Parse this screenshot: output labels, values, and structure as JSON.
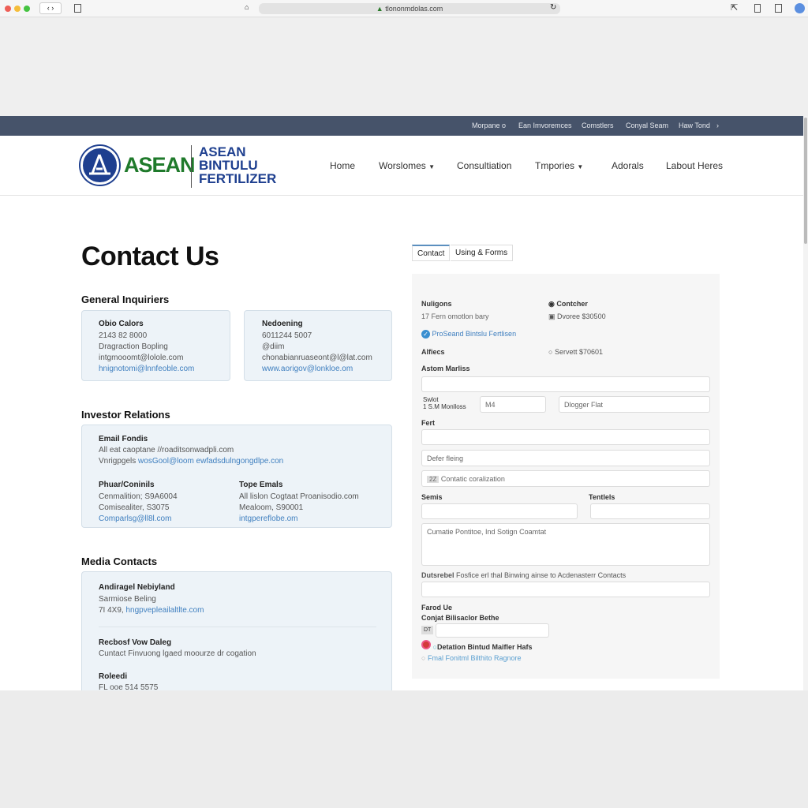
{
  "browser": {
    "url": "tlononmdolas.com"
  },
  "topbar": {
    "links": [
      "Morpane o",
      "Ean Imvoremces",
      "Comstlers",
      "Conyal Seam",
      "Haw Tond"
    ]
  },
  "logo": {
    "word": "ASEAN",
    "line1": "ASEAN",
    "line2": "BINTULU",
    "line3": "FERTILIZER"
  },
  "nav": {
    "items": [
      "Home",
      "Worslomes",
      "Consultiation",
      "Tmpories",
      "Adorals",
      "Labout Heres"
    ]
  },
  "page": {
    "title": "Contact Us"
  },
  "general": {
    "heading": "General Inquiriers",
    "card1": [
      "Obio Calors",
      "2143 82 8000",
      "Dragraction Bopling",
      "intgmooomt@lolole.com",
      "hnignotomi@lnnfeoble.com"
    ],
    "card2": [
      "Nedoening",
      "6011244 5007",
      "@diim",
      "chonabianruaseont@l@lat.com",
      "www.aorigov@lonkloe.om"
    ]
  },
  "investor": {
    "heading": "Investor Relations",
    "email_title": "Email Fondis",
    "email_line1": "All eat caoptane //roaditsonwadpli.com",
    "email_prefix": "Vnrigpgels",
    "email_link": "wosGool@loom ewfadsdulngongdlpe.con",
    "phone_title": "Phuar/Coninils",
    "phone_lines": [
      "Cenmalition; S9A6004",
      "Comisealiter, S3075",
      "Comparlsg@ll8l.com"
    ],
    "type_title": "Tope Emals",
    "type_lines": [
      "All lislon Cogtaat Proanisodio.com",
      "Mealoom, S90001",
      "intgpereflobe.om"
    ]
  },
  "media": {
    "heading": "Media Contacts",
    "c1": [
      "Andiragel Nebiyland",
      "Sarmiose Beling",
      "7I 4X9,",
      "hngpvepleailaltlte.com"
    ],
    "c2": [
      "Recbosf Vow Daleg",
      "Cuntact Finvuong lgaed moourze dr cogation"
    ],
    "c3": [
      "Roleedi",
      "FL ooe 514 5575"
    ]
  },
  "tabs": [
    "Contact",
    "Using & Forms"
  ],
  "form": {
    "l1": "Nuligons",
    "l1sub": "17 Fern omotlon bary",
    "r1": "Contcher",
    "r2": "Dvoree $30500",
    "r3": "Servett $70601",
    "check": "ProSeand Bintslu Fertlisen",
    "l2": "Alfiecs",
    "l3": "Astom Marliss",
    "small_l": "Swlot",
    "small_sub": "1 S.M Monlloss",
    "in_m": "M4",
    "in_p": "Dlogger Flat",
    "l4": "Fert",
    "in_d": "Defer fleing",
    "in_c_badge": "2Z",
    "in_c": "Contatic coralization",
    "l5": "Semis",
    "l6": "Tentlels",
    "textarea": "Cumatie Pontitoe, Ind Sotign Coamtat",
    "l7b": "Dutsrebel",
    "l7": "Fosfice erl thal Binwing ainse to Acdenasterr Contacts",
    "l8": "Farod Ue",
    "l9": "Conjat Bilisaclor Bethe",
    "in_badge": "DT",
    "opt1": "Detation Bintud Maifler Hafs",
    "opt2": "Fmal Fonitml Bilthito Ragnore"
  },
  "colors": {
    "topbar": "#46536a",
    "brand_green": "#1f7a2b",
    "brand_blue": "#1e3f8f",
    "link": "#3f7fbf"
  }
}
